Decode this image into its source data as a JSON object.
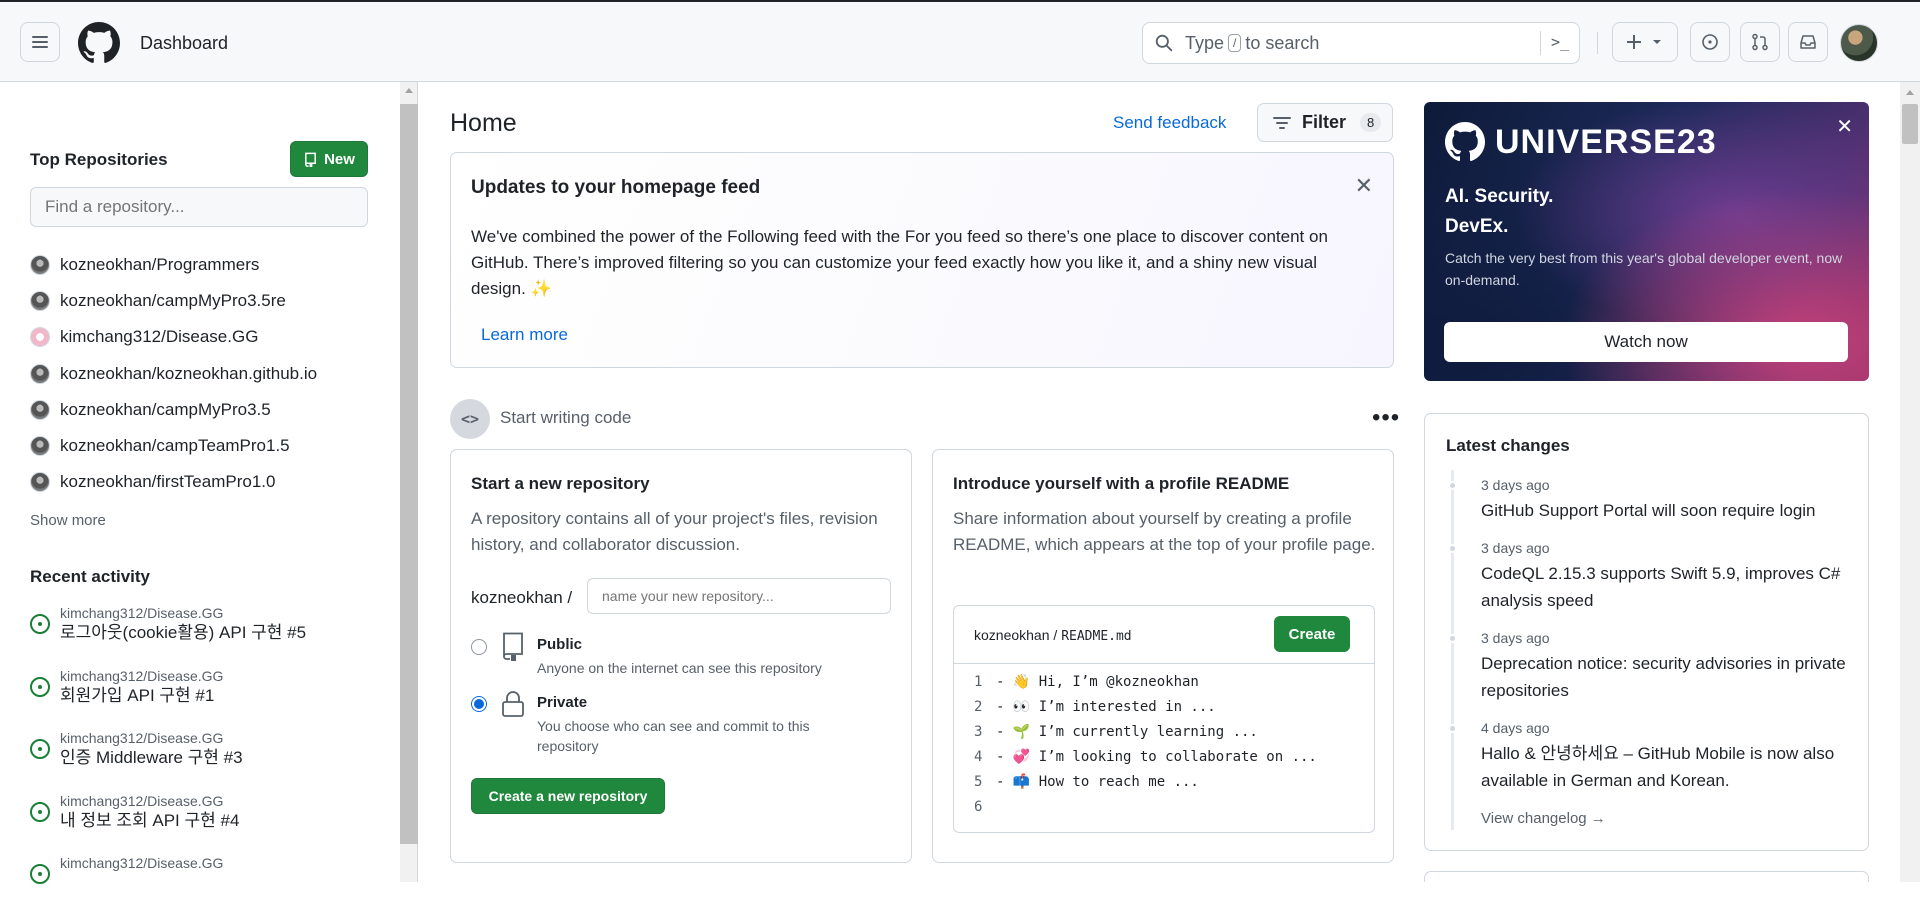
{
  "header": {
    "title": "Dashboard",
    "search_placeholder_pre": "Type",
    "search_key": "/",
    "search_placeholder_post": "to search",
    "command_glyph": ">_",
    "icons": [
      "menu-icon",
      "github-logo-icon",
      "search-icon",
      "command-palette-icon",
      "plus-icon",
      "chevron-down-icon",
      "issues-icon",
      "pull-requests-icon",
      "inbox-icon",
      "avatar"
    ]
  },
  "sidebar": {
    "top_repos_title": "Top Repositories",
    "new_label": "New",
    "find_placeholder": "Find a repository...",
    "repos": [
      {
        "name": "kozneokhan/Programmers"
      },
      {
        "name": "kozneokhan/campMyPro3.5re"
      },
      {
        "name": "kimchang312/Disease.GG"
      },
      {
        "name": "kozneokhan/kozneokhan.github.io"
      },
      {
        "name": "kozneokhan/campMyPro3.5"
      },
      {
        "name": "kozneokhan/campTeamPro1.5"
      },
      {
        "name": "kozneokhan/firstTeamPro1.0"
      }
    ],
    "show_more": "Show more",
    "recent_title": "Recent activity",
    "activity": [
      {
        "repo": "kimchang312/Disease.GG",
        "title": "로그아웃(cookie활용) API 구현 #5"
      },
      {
        "repo": "kimchang312/Disease.GG",
        "title": "회원가입 API 구현 #1"
      },
      {
        "repo": "kimchang312/Disease.GG",
        "title": "인증 Middleware 구현 #3"
      },
      {
        "repo": "kimchang312/Disease.GG",
        "title": "내 정보 조회 API 구현 #4"
      },
      {
        "repo": "kimchang312/Disease.GG",
        "title": ""
      }
    ]
  },
  "main": {
    "title": "Home",
    "send_feedback": "Send feedback",
    "filter_label": "Filter",
    "filter_count": "8",
    "update": {
      "title": "Updates to your homepage feed",
      "body": "We've combined the power of the Following feed with the For you feed so there’s one place to discover content on GitHub. There’s improved filtering so you can customize your feed exactly how you like it, and a shiny new visual design. ✨",
      "learn_more": "Learn more"
    },
    "start_writing": "Start writing code",
    "new_repo": {
      "title": "Start a new repository",
      "desc": "A repository contains all of your project's files, revision history, and collaborator discussion.",
      "owner": "kozneokhan /",
      "name_placeholder": "name your new repository...",
      "public_title": "Public",
      "public_desc": "Anyone on the internet can see this repository",
      "private_title": "Private",
      "private_desc": "You choose who can see and commit to this repository",
      "private_selected": true,
      "create_label": "Create a new repository"
    },
    "readme": {
      "title": "Introduce yourself with a profile README",
      "desc": "Share information about yourself by creating a profile README, which appears at the top of your profile page.",
      "path_user": "kozneokhan",
      "path_sep": "/",
      "path_file": "README.md",
      "create_label": "Create",
      "lines": [
        {
          "n": "1",
          "text": "- 👋 Hi, I’m @kozneokhan"
        },
        {
          "n": "2",
          "text": "- 👀 I’m interested in ..."
        },
        {
          "n": "3",
          "text": "- 🌱 I’m currently learning ..."
        },
        {
          "n": "4",
          "text": "- 💞️ I’m looking to collaborate on ..."
        },
        {
          "n": "5",
          "text": "- 📫 How to reach me ..."
        },
        {
          "n": "6",
          "text": ""
        }
      ]
    }
  },
  "right": {
    "promo": {
      "brand": "UNIVERSE23",
      "line1": "AI. Security.",
      "line2": "DevEx.",
      "desc": "Catch the very best from this year's global developer event, now on-demand.",
      "cta": "Watch now"
    },
    "changes": {
      "title": "Latest changes",
      "items": [
        {
          "time": "3 days ago",
          "title": "GitHub Support Portal will soon require login"
        },
        {
          "time": "3 days ago",
          "title": "CodeQL 2.15.3 supports Swift 5.9, improves C# analysis speed"
        },
        {
          "time": "3 days ago",
          "title": "Deprecation notice: security advisories in private repositories"
        },
        {
          "time": "4 days ago",
          "title": "Hallo & 안녕하세요 – GitHub Mobile is now also available in German and Korean."
        }
      ],
      "view_changelog": "View changelog →"
    }
  }
}
